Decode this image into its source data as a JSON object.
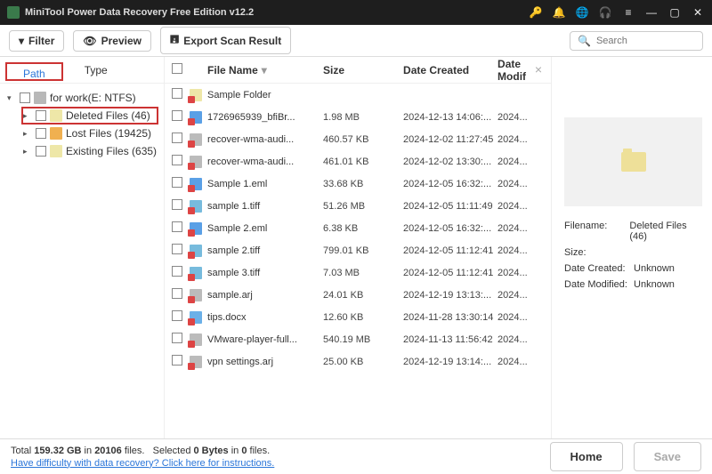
{
  "titlebar": {
    "title": "MiniTool Power Data Recovery Free Edition v12.2"
  },
  "toolbar": {
    "filter": "Filter",
    "preview": "Preview",
    "export": "Export Scan Result",
    "search_placeholder": "Search"
  },
  "tabs": {
    "path": "Path",
    "type": "Type"
  },
  "tree": {
    "root": "for work(E: NTFS)",
    "deleted": "Deleted Files (46)",
    "lost": "Lost Files (19425)",
    "existing": "Existing Files (635)"
  },
  "columns": {
    "name": "File Name",
    "size": "Size",
    "created": "Date Created",
    "modified": "Date Modif"
  },
  "files": [
    {
      "name": "Sample Folder",
      "size": "",
      "created": "",
      "modified": "",
      "ico": "fi-folder"
    },
    {
      "name": "1726965939_bfiBr...",
      "size": "1.98 MB",
      "created": "2024-12-13 14:06:...",
      "modified": "2024...",
      "ico": "fi-blue"
    },
    {
      "name": "recover-wma-audi...",
      "size": "460.57 KB",
      "created": "2024-12-02 11:27:45",
      "modified": "2024...",
      "ico": "fi-gray"
    },
    {
      "name": "recover-wma-audi...",
      "size": "461.01 KB",
      "created": "2024-12-02 13:30:...",
      "modified": "2024...",
      "ico": "fi-gray"
    },
    {
      "name": "Sample 1.eml",
      "size": "33.68 KB",
      "created": "2024-12-05 16:32:...",
      "modified": "2024...",
      "ico": "fi-blue"
    },
    {
      "name": "sample 1.tiff",
      "size": "51.26 MB",
      "created": "2024-12-05 11:11:49",
      "modified": "2024...",
      "ico": "fi-img"
    },
    {
      "name": "Sample 2.eml",
      "size": "6.38 KB",
      "created": "2024-12-05 16:32:...",
      "modified": "2024...",
      "ico": "fi-blue"
    },
    {
      "name": "sample 2.tiff",
      "size": "799.01 KB",
      "created": "2024-12-05 11:12:41",
      "modified": "2024...",
      "ico": "fi-img"
    },
    {
      "name": "sample 3.tiff",
      "size": "7.03 MB",
      "created": "2024-12-05 11:12:41",
      "modified": "2024...",
      "ico": "fi-img"
    },
    {
      "name": "sample.arj",
      "size": "24.01 KB",
      "created": "2024-12-19 13:13:...",
      "modified": "2024...",
      "ico": "fi-gray"
    },
    {
      "name": "tips.docx",
      "size": "12.60 KB",
      "created": "2024-11-28 13:30:14",
      "modified": "2024...",
      "ico": "fi-doc"
    },
    {
      "name": "VMware-player-full...",
      "size": "540.19 MB",
      "created": "2024-11-13 11:56:42",
      "modified": "2024...",
      "ico": "fi-gray"
    },
    {
      "name": "vpn settings.arj",
      "size": "25.00 KB",
      "created": "2024-12-19 13:14:...",
      "modified": "2024...",
      "ico": "fi-gray"
    }
  ],
  "preview": {
    "filename_lbl": "Filename:",
    "filename": "Deleted Files (46)",
    "size_lbl": "Size:",
    "size": "",
    "created_lbl": "Date Created:",
    "created": "Unknown",
    "modified_lbl": "Date Modified:",
    "modified": "Unknown"
  },
  "bottom": {
    "stats_html": "Total <b>159.32 GB</b> in <b>20106</b> files. &nbsp; Selected <b>0 Bytes</b> in <b>0</b> files.",
    "help": "Have difficulty with data recovery? Click here for instructions.",
    "home": "Home",
    "save": "Save"
  }
}
